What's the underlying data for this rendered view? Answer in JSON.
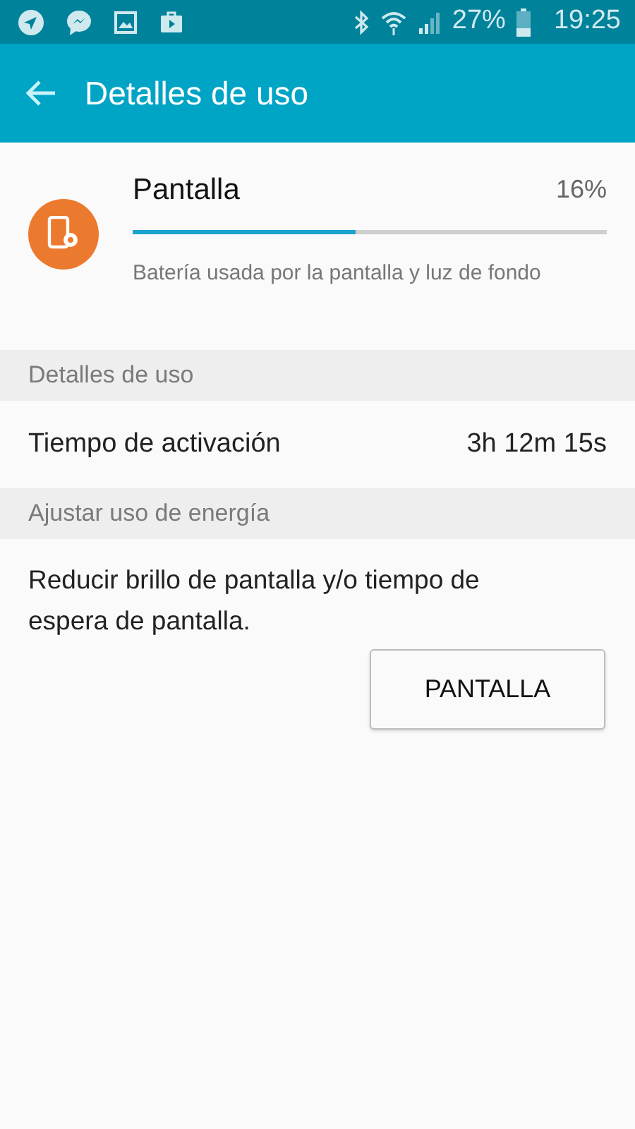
{
  "status_bar": {
    "battery_text": "27%",
    "time": "19:25"
  },
  "app_bar": {
    "title": "Detalles de uso"
  },
  "usage_item": {
    "name": "Pantalla",
    "percent": "16%",
    "level": 0.47,
    "description": "Batería usada por la pantalla y luz de fondo"
  },
  "sections": [
    {
      "kind": "rows",
      "header": "Detalles de uso",
      "rows": [
        {
          "label": "Tiempo de activación",
          "value": "3h 12m 15s"
        }
      ]
    },
    {
      "kind": "action",
      "header": "Ajustar uso de energía",
      "text": "Reducir brillo de pantalla y/o tiempo de espera de pantalla.",
      "button": "PANTALLA"
    }
  ]
}
